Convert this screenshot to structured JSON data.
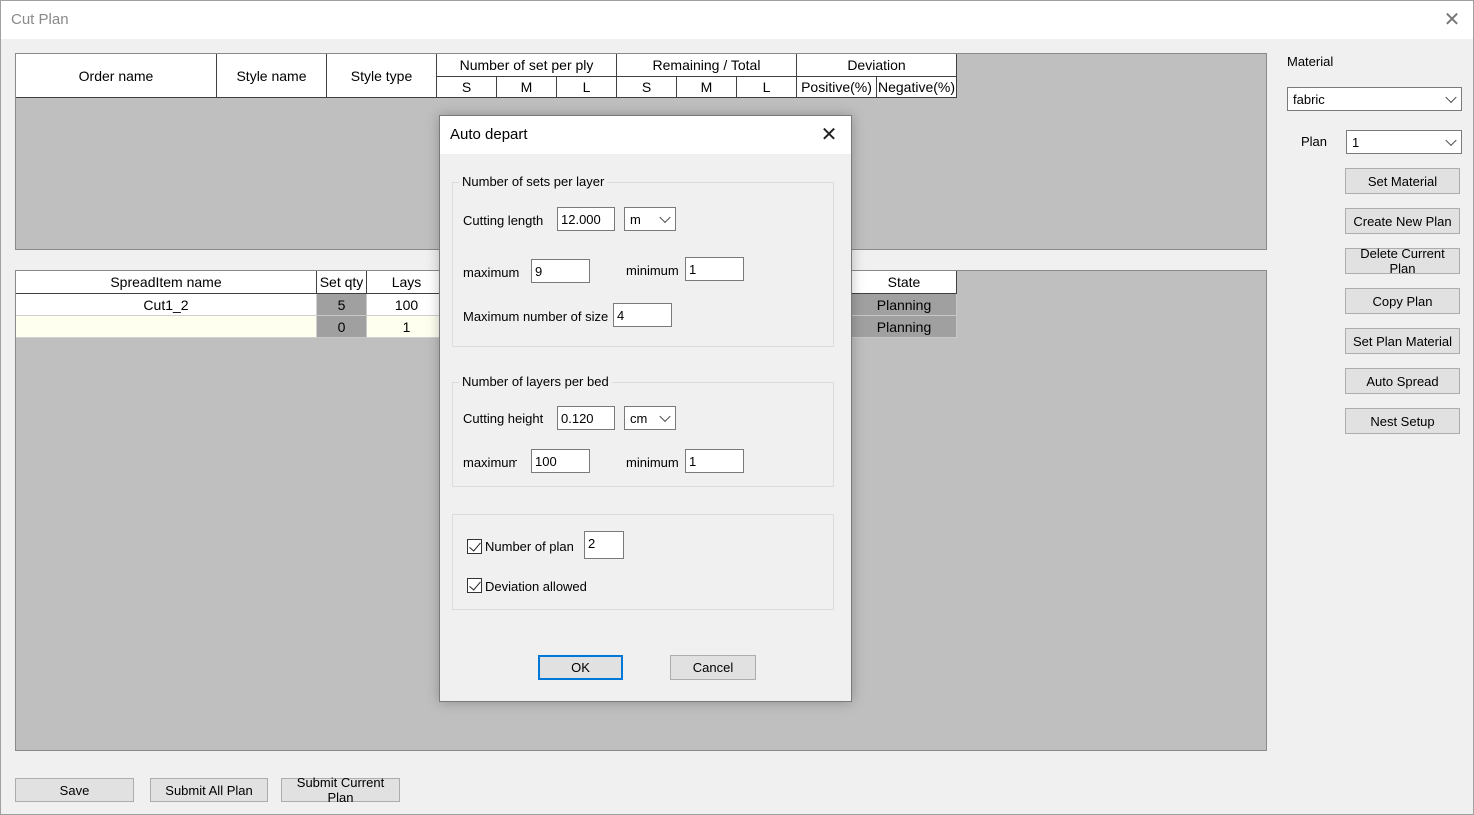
{
  "window": {
    "title": "Cut Plan",
    "close_glyph": "✕"
  },
  "top_grid": {
    "headers": {
      "order_name": "Order name",
      "style_name": "Style name",
      "style_type": "Style type",
      "number_per_ply": "Number of set per ply",
      "remaining_total": "Remaining / Total",
      "deviation": "Deviation",
      "sizes_a": [
        "S",
        "M",
        "L"
      ],
      "sizes_b": [
        "S",
        "M",
        "L"
      ],
      "positive": "Positive(%)",
      "negative": "Negative(%)"
    }
  },
  "bottom_grid": {
    "headers": {
      "spread_item_name": "SpreadItem name",
      "set_qty": "Set qty",
      "lays": "Lays",
      "state": "State"
    },
    "rows": [
      {
        "name": "Cut1_2",
        "set_qty": "5",
        "lays": "100",
        "state": "Planning"
      },
      {
        "name": "",
        "set_qty": "0",
        "lays": "1",
        "state": "Planning"
      }
    ]
  },
  "right_panel": {
    "material_label": "Material",
    "material_value": "fabric",
    "plan_label": "Plan",
    "plan_value": "1",
    "buttons": {
      "set_material": "Set Material",
      "create_new_plan": "Create New Plan",
      "delete_current_plan": "Delete Current Plan",
      "copy_plan": "Copy Plan",
      "set_plan_material": "Set Plan Material",
      "auto_spread": "Auto Spread",
      "nest_setup": "Nest Setup"
    }
  },
  "bottom_buttons": {
    "save": "Save",
    "submit_all": "Submit All Plan",
    "submit_current": "Submit Current Plan"
  },
  "dialog": {
    "title": "Auto depart",
    "close_glyph": "✕",
    "sets_group": {
      "legend": "Number of sets per layer",
      "cutting_length_label": "Cutting length",
      "cutting_length_value": "12.000",
      "length_unit": "m",
      "maximum_label": "maximum",
      "maximum_value": "9",
      "minimum_label": "minimum",
      "minimum_value": "1",
      "max_size_label": "Maximum number of size",
      "max_size_value": "4"
    },
    "layers_group": {
      "legend": "Number of layers per bed",
      "cutting_height_label": "Cutting height",
      "cutting_height_value": "0.120",
      "height_unit": "cm",
      "maximum_label": "maximum",
      "maximum_value": "100",
      "minimum_label": "minimum",
      "minimum_value": "1"
    },
    "options": {
      "number_of_plan_label": "Number of plan",
      "number_of_plan_value": "2",
      "number_of_plan_checked": true,
      "deviation_label": "Deviation allowed",
      "deviation_checked": true
    },
    "ok": "OK",
    "cancel": "Cancel"
  }
}
